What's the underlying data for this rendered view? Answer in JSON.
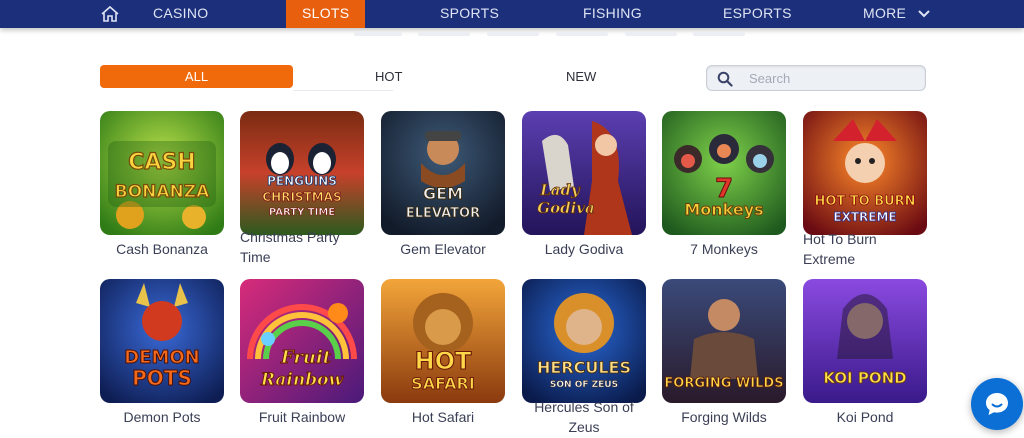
{
  "nav": {
    "home_icon": "home-icon",
    "items": [
      {
        "label": "CASINO"
      },
      {
        "label": "SLOTS",
        "active": true
      },
      {
        "label": "SPORTS"
      },
      {
        "label": "FISHING"
      },
      {
        "label": "ESPORTS"
      },
      {
        "label": "MORE"
      }
    ],
    "colors": {
      "bar": "#1c2f7a",
      "active": "#e8600e"
    }
  },
  "filters": {
    "tabs": [
      {
        "label": "ALL",
        "active": true
      },
      {
        "label": "HOT"
      },
      {
        "label": "NEW"
      }
    ],
    "search": {
      "placeholder": "Search",
      "value": ""
    }
  },
  "games": [
    {
      "title": "Cash Bonanza",
      "logo": "CASH BONANZA"
    },
    {
      "title": "Christmas Party Time",
      "logo": "PENGUINS CHRISTMAS PARTY TIME"
    },
    {
      "title": "Gem Elevator",
      "logo": "GEM ELEVATOR"
    },
    {
      "title": "Lady Godiva",
      "logo": "Lady Godiva"
    },
    {
      "title": "7 Monkeys",
      "logo": "7 Monkeys"
    },
    {
      "title": "Hot To Burn Extreme",
      "logo": "HOT TO BURN EXTREME"
    },
    {
      "title": "Demon Pots",
      "logo": "DEMON POTS"
    },
    {
      "title": "Fruit Rainbow",
      "logo": "Fruit Rainbow"
    },
    {
      "title": "Hot Safari",
      "logo": "HOT SAFARI"
    },
    {
      "title": "Hercules Son of Zeus",
      "logo": "HERCULES SON OF ZEUS"
    },
    {
      "title": "Forging Wilds",
      "logo": "FORGING WILDS"
    },
    {
      "title": "Koi Pond",
      "logo": "KOI POND"
    }
  ],
  "chat": {
    "icon": "chat-bubble-icon",
    "color": "#0b6fd6"
  }
}
